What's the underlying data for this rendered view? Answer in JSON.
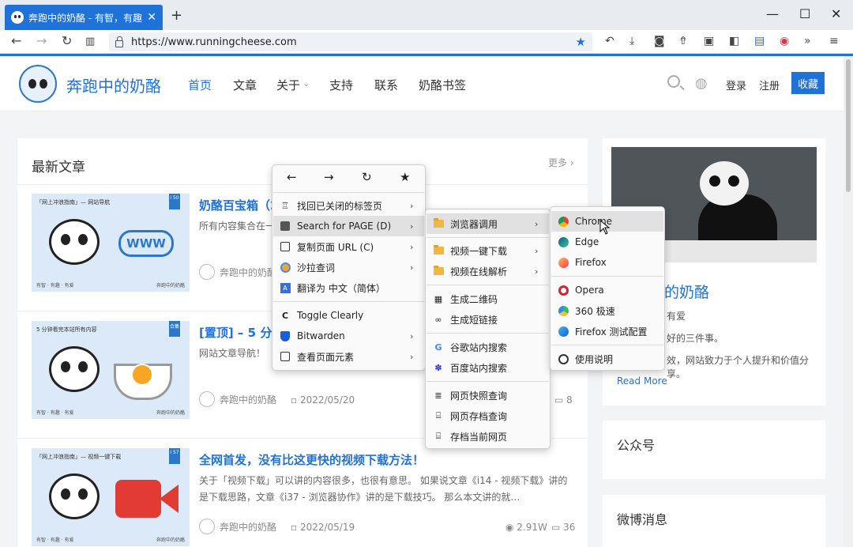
{
  "browser": {
    "tab_title": "奔跑中的奶酪 - 有智，有趣，有爱",
    "tab_close": "✕",
    "new_tab": "+",
    "url": "https://www.runningcheese.com",
    "win_min": "—",
    "win_max": "☐",
    "win_close": "✕"
  },
  "site": {
    "name": "奔跑中的奶酪",
    "nav": [
      "首页",
      "文章",
      "关于",
      "支持",
      "联系",
      "奶酪书签"
    ],
    "nav_about_caret": "⌄",
    "login": "登录",
    "register": "注册",
    "collect": "收藏"
  },
  "main": {
    "title": "最新文章",
    "more": "更多 ›",
    "articles": [
      {
        "title": "奶酪百宝箱（2",
        "desc": "所有内容集合在一",
        "author": "奔跑中的奶酪",
        "thumb_caption": "「网上冲浪指南」— 网站导航",
        "thumb_num": "i 50",
        "thumb_foot_left": "有智 · 有趣 · 有爱",
        "thumb_foot_right": "奔跑中的奶酪",
        "thumb_graphic": "WWW"
      },
      {
        "title": "[置顶] – 5 分钟",
        "desc": "网站文章导航！",
        "author": "奔跑中的奶酪",
        "date": "2022/05/20",
        "comments": "8",
        "thumb_caption": "5 分钟看完本站所有内容",
        "thumb_num": "合集",
        "thumb_foot_left": "有智 · 有趣 · 有爱",
        "thumb_foot_right": "奔跑中的奶酪"
      },
      {
        "title": "全网首发，没有比这更快的视频下载方法！",
        "desc": "关于「视频下载」可以讲的内容很多，也很有意思。 如果说文章《i14 - 视频下载》讲的是下载思路，文章《i37 - 浏览器协作》讲的是下载技巧。 那么本文讲的就…",
        "author": "奔跑中的奶酪",
        "date": "2022/05/19",
        "views": "2.91W",
        "comments": "36",
        "thumb_caption": "「网上冲浪指南」— 视频一键下载",
        "thumb_num": "i 57",
        "thumb_foot_left": "有智 · 有趣 · 有爱",
        "thumb_foot_right": "奔跑中的奶酪"
      }
    ]
  },
  "sidebar": {
    "title": "的奶酪",
    "line1": "有爱",
    "line2": "好的三件事。",
    "line3": "效，网站致力于个人提升和价值分享。",
    "read_more": "Read More",
    "box2_title": "公众号",
    "box3_title": "微博消息"
  },
  "ctx_main": {
    "items": [
      {
        "label": "找回已关闭的标签页"
      },
      {
        "label": "Search for PAGE (D)"
      },
      {
        "label": "复制页面 URL (C)"
      },
      {
        "label": "沙拉查词"
      },
      {
        "label": "翻译为 中文（简体）"
      },
      {
        "label": "Toggle Clearly"
      },
      {
        "label": "Bitwarden"
      },
      {
        "label": "查看页面元素"
      }
    ]
  },
  "ctx_sub": {
    "items": [
      {
        "label": "浏览器调用"
      },
      {
        "label": "视频一键下载"
      },
      {
        "label": "视频在线解析"
      },
      {
        "label": "生成二维码"
      },
      {
        "label": "生成短链接"
      },
      {
        "label": "谷歌站内搜索"
      },
      {
        "label": "百度站内搜索"
      },
      {
        "label": "网页快照查询"
      },
      {
        "label": "网页存档查询"
      },
      {
        "label": "存档当前网页"
      }
    ]
  },
  "ctx_browsers": {
    "items": [
      {
        "label": "Chrome"
      },
      {
        "label": "Edge"
      },
      {
        "label": "Firefox"
      },
      {
        "label": "Opera"
      },
      {
        "label": "360 极速"
      },
      {
        "label": "Firefox 测试配置"
      },
      {
        "label": "使用说明"
      }
    ]
  },
  "colors": {
    "accent": "#1f73d8",
    "folder": "#f0b840",
    "menu_highlight": "#e1e1e1"
  }
}
